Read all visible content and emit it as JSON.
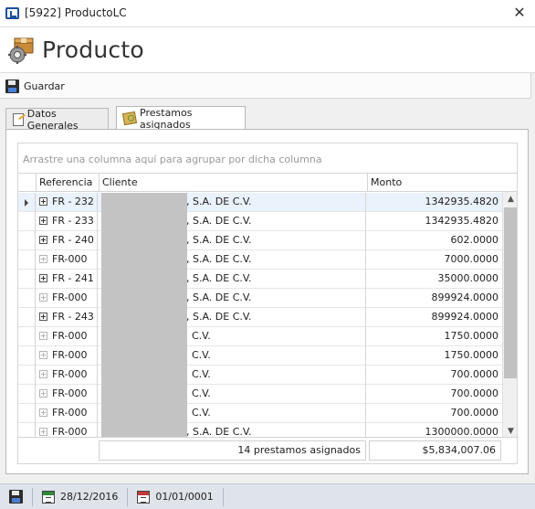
{
  "window": {
    "title": "[5922] ProductoLC",
    "close_glyph": "✕"
  },
  "header": {
    "title": "Producto",
    "icon": "product-box-gear-icon"
  },
  "toolbar": {
    "save_label": "Guardar"
  },
  "tabs": [
    {
      "label": "Datos Generales",
      "active": false
    },
    {
      "label": "Prestamos asignados",
      "active": true
    }
  ],
  "grid": {
    "group_hint": "Arrastre una columna aquí para agrupar por dicha columna",
    "columns": [
      "Referencia",
      "Cliente",
      "Monto"
    ],
    "rows": [
      {
        "ref": "FR - 232",
        "cliente": ", S.A. DE C.V.",
        "monto": "1342935.4820",
        "expandable": true
      },
      {
        "ref": "FR - 233",
        "cliente": ", S.A. DE C.V.",
        "monto": "1342935.4820",
        "expandable": true
      },
      {
        "ref": "FR - 240",
        "cliente": ", S.A. DE C.V.",
        "monto": "602.0000",
        "expandable": true
      },
      {
        "ref": "FR-000",
        "cliente": ", S.A. DE C.V.",
        "monto": "7000.0000",
        "expandable": false
      },
      {
        "ref": "FR - 241",
        "cliente": ", S.A. DE C.V.",
        "monto": "35000.0000",
        "expandable": true
      },
      {
        "ref": "FR-000",
        "cliente": ", S.A. DE C.V.",
        "monto": "899924.0000",
        "expandable": false
      },
      {
        "ref": "FR - 243",
        "cliente": ", S.A. DE C.V.",
        "monto": "899924.0000",
        "expandable": true
      },
      {
        "ref": "FR-000",
        "cliente": "C.V.",
        "monto": "1750.0000",
        "expandable": false
      },
      {
        "ref": "FR-000",
        "cliente": "C.V.",
        "monto": "1750.0000",
        "expandable": false
      },
      {
        "ref": "FR-000",
        "cliente": "C.V.",
        "monto": "700.0000",
        "expandable": false
      },
      {
        "ref": "FR-000",
        "cliente": "C.V.",
        "monto": "700.0000",
        "expandable": false
      },
      {
        "ref": "FR-000",
        "cliente": "C.V.",
        "monto": "700.0000",
        "expandable": false
      },
      {
        "ref": "FR-000",
        "cliente": ", S.A. DE C.V.",
        "monto": "1300000.0000",
        "expandable": false
      }
    ],
    "footer_count": "14 prestamos asignados",
    "footer_total": "$5,834,007.06"
  },
  "statusbar": {
    "date1": "28/12/2016",
    "date2": "01/01/0001"
  }
}
